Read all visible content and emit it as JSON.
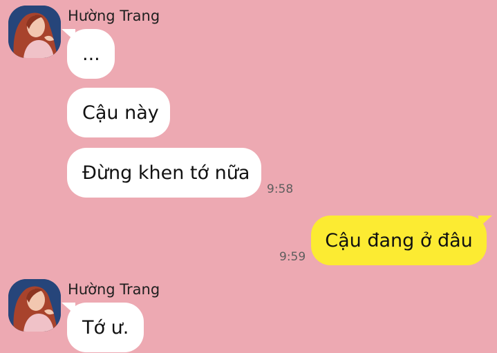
{
  "colors": {
    "background": "#eda9b2",
    "incoming_bubble": "#ffffff",
    "outgoing_bubble": "#fceb32"
  },
  "messages": {
    "group1": {
      "sender": "Hường Trang",
      "avatar_icon": "user-avatar-photo",
      "m1": "...",
      "m2": "Cậu này",
      "m3": "Đừng khen tớ nữa",
      "time": "9:58"
    },
    "mine": {
      "m1": "Cậu đang ở đâu",
      "time": "9:59"
    },
    "group2": {
      "sender": "Hường Trang",
      "avatar_icon": "user-avatar-photo",
      "m1": "Tớ ư."
    }
  }
}
